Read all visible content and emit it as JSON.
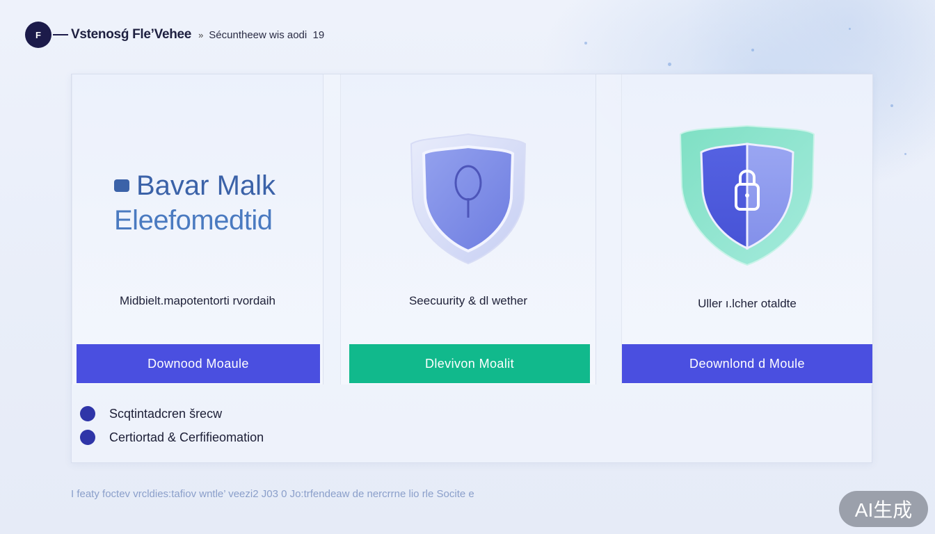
{
  "header": {
    "logo_letter": "F",
    "brand": "Vstenosǵ Fle’Vehee",
    "separator": "»",
    "crumb": "Sécuntheew wis aodi​  19"
  },
  "hero": {
    "line1": "Bavar Malk",
    "line2": "Eleefomedtid"
  },
  "cards": [
    {
      "label": "Midbielt.mapotentorti rvordaih",
      "button": "Downood Moaule",
      "button_color": "#4a4fe0"
    },
    {
      "label": "Seecuurity & dl wether",
      "button": "Dlevivon Moalit",
      "button_color": "#11b98c",
      "icon": "shield-icon"
    },
    {
      "label": "Uller ı.lcher otaldte",
      "button": "Deownlond d Moule",
      "button_color": "#4a4fe0",
      "icon": "shield-lock-icon"
    }
  ],
  "features": [
    "Scqtintadcren šrecw",
    "Certiortad & Cerfifieomation"
  ],
  "footer": "I featy foctev vrcldies:tafiov wntle’ veezi2 J03 0 Jo:trfendeaw de nercrrne lio rle Socite e",
  "badge": "AI生成"
}
